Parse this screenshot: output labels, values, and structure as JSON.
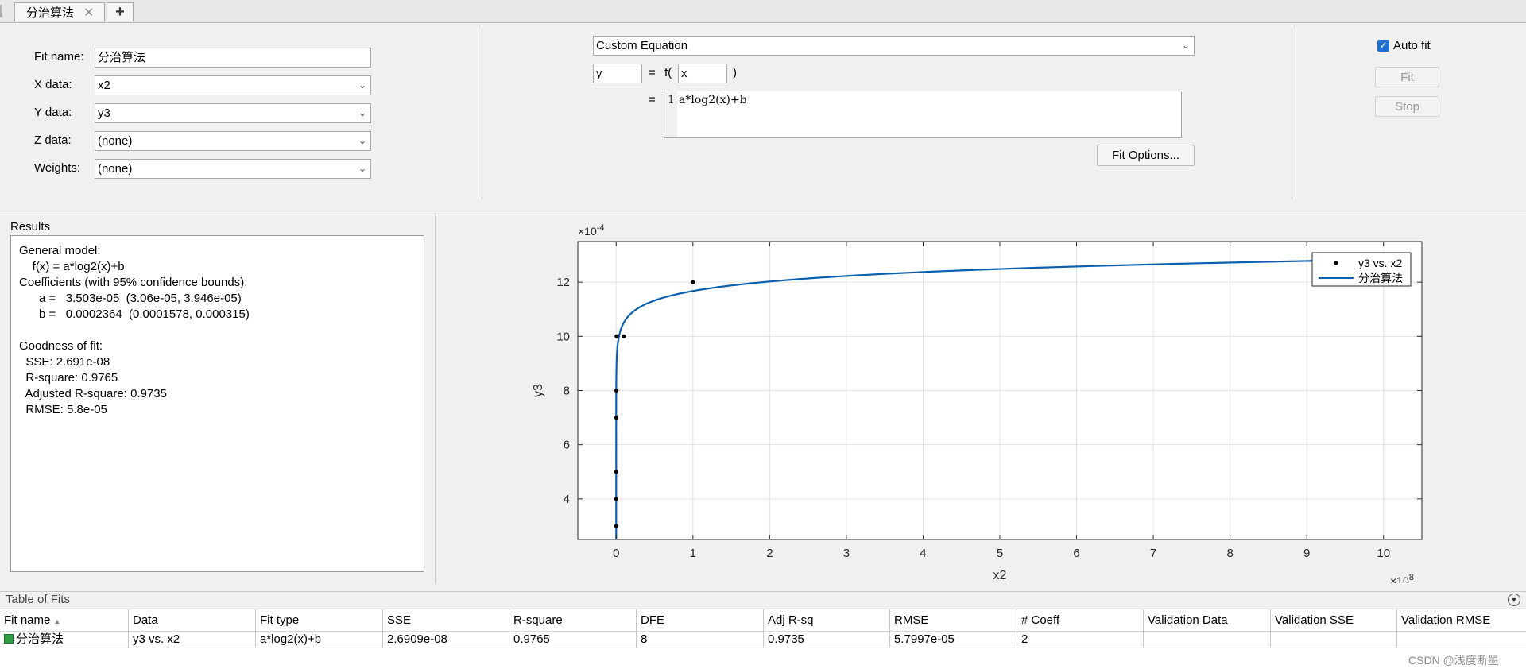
{
  "tabs": {
    "active_label": "分治算法",
    "close_glyph": "✕",
    "add_glyph": "+"
  },
  "fit_setup": {
    "fit_name_label": "Fit name:",
    "fit_name_value": "分治算法",
    "x_data_label": "X data:",
    "x_data_value": "x2",
    "y_data_label": "Y data:",
    "y_data_value": "y3",
    "z_data_label": "Z data:",
    "z_data_value": "(none)",
    "weights_label": "Weights:",
    "weights_value": "(none)"
  },
  "equation": {
    "type_value": "Custom Equation",
    "dependent_var": "y",
    "equals_label": "=",
    "f_label": "f(",
    "independent_var": "x",
    "close_paren": ")",
    "equals2_label": "=",
    "line_number": "1",
    "expression": "a*log2(x)+b",
    "fit_options_label": "Fit Options..."
  },
  "controls": {
    "auto_fit_label": "Auto fit",
    "auto_fit_checked": true,
    "fit_label": "Fit",
    "stop_label": "Stop"
  },
  "results": {
    "title": "Results",
    "lines": [
      "General model:",
      "    f(x) = a*log2(x)+b",
      "Coefficients (with 95% confidence bounds):",
      "      a =   3.503e-05  (3.06e-05, 3.946e-05)",
      "      b =   0.0002364  (0.0001578, 0.000315)",
      "",
      "Goodness of fit:",
      "  SSE: 2.691e-08",
      "  R-square: 0.9765",
      "  Adjusted R-square: 0.9735",
      "  RMSE: 5.8e-05"
    ]
  },
  "chart_data": {
    "type": "scatter",
    "xlabel": "x2",
    "ylabel": "y3",
    "x_exponent_label": "×10^8",
    "y_exponent_label": "×10^-4",
    "xlim": [
      -0.5,
      10.5
    ],
    "ylim": [
      2.5,
      13.5
    ],
    "x_ticks": [
      0,
      1,
      2,
      3,
      4,
      5,
      6,
      7,
      8,
      9,
      10
    ],
    "y_ticks": [
      4,
      6,
      8,
      10,
      12
    ],
    "grid": true,
    "legend_position": "top-right",
    "series": [
      {
        "name": "y3 vs. x2",
        "kind": "points",
        "color": "#000000",
        "x": [
          0.0001,
          0.0003,
          0.001,
          0.002,
          0.003,
          0.005,
          0.01,
          0.1,
          1.0
        ],
        "y": [
          3,
          4,
          5,
          7,
          8,
          10,
          10,
          10,
          12
        ]
      },
      {
        "name": "分治算法",
        "kind": "curve",
        "color": "#0b5fb0",
        "equation": "a*log2(x)+b",
        "a": 3.503e-05,
        "b": 0.0002364
      }
    ]
  },
  "table_of_fits": {
    "title": "Table of Fits",
    "columns": [
      "Fit name",
      "Data",
      "Fit type",
      "SSE",
      "R-square",
      "DFE",
      "Adj R-sq",
      "RMSE",
      "# Coeff",
      "Validation Data",
      "Validation SSE",
      "Validation RMSE"
    ],
    "sort_glyph": "▲",
    "rows": [
      {
        "status_color": "#2ea043",
        "cells": [
          "分治算法",
          "y3 vs. x2",
          "a*log2(x)+b",
          "2.6909e-08",
          "0.9765",
          "8",
          "0.9735",
          "5.7997e-05",
          "2",
          "",
          "",
          ""
        ]
      }
    ]
  },
  "watermark": "CSDN @浅度断墨"
}
